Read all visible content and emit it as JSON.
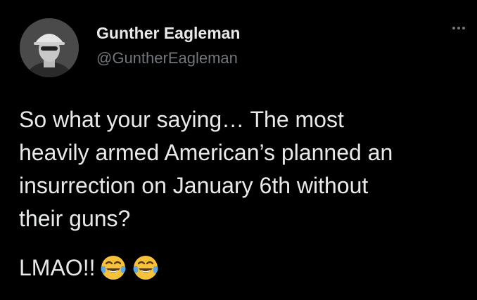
{
  "tweet": {
    "author_name": "Gunther Eagleman",
    "author_handle": "@GuntherEagleman",
    "more_icon": "more-horizontal-icon",
    "text_lines": [
      "So what your saying… The most",
      "heavily armed American’s planned an",
      "insurrection on January 6th without",
      "their guns?"
    ],
    "closing_text": "LMAO!!",
    "emojis": [
      "face-with-tears-of-joy-icon",
      "face-with-tears-of-joy-icon"
    ]
  },
  "colors": {
    "background": "#000000",
    "primary_text": "#e7e9ea",
    "secondary_text": "#71767b",
    "emoji_yellow": "#f7c23b",
    "emoji_tears": "#5aa8e8"
  }
}
